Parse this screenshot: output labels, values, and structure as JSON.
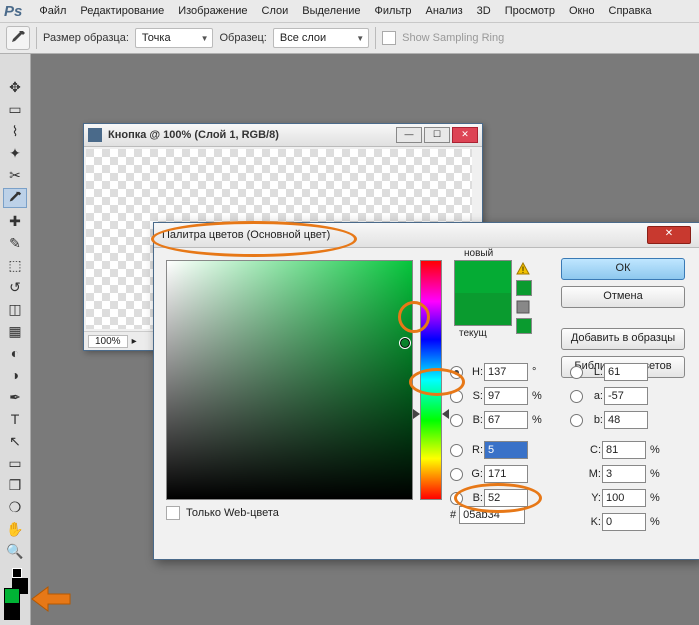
{
  "menu": {
    "logo": "Ps",
    "items": [
      "Файл",
      "Редактирование",
      "Изображение",
      "Слои",
      "Выделение",
      "Фильтр",
      "Анализ",
      "3D",
      "Просмотр",
      "Окно",
      "Справка"
    ]
  },
  "options": {
    "sample_label": "Размер образца:",
    "sample_value": "Точка",
    "target_label": "Образец:",
    "target_value": "Все слои",
    "ring": "Show Sampling Ring"
  },
  "doc": {
    "title": "Кнопка @ 100% (Слой 1, RGB/8)",
    "zoom": "100%"
  },
  "picker": {
    "title": "Палитра цветов (Основной цвет)",
    "new_label": "новый",
    "current_label": "текущ",
    "ok": "ОК",
    "cancel": "Отмена",
    "add": "Добавить в образцы",
    "libs": "Библиотеки цветов",
    "H": {
      "l": "H:",
      "v": "137",
      "u": "°"
    },
    "S": {
      "l": "S:",
      "v": "97",
      "u": "%"
    },
    "Bv": {
      "l": "B:",
      "v": "67",
      "u": "%"
    },
    "R": {
      "l": "R:",
      "v": "5",
      "u": ""
    },
    "G": {
      "l": "G:",
      "v": "171",
      "u": ""
    },
    "Bb": {
      "l": "B:",
      "v": "52",
      "u": ""
    },
    "L": {
      "l": "L:",
      "v": "61",
      "u": ""
    },
    "a": {
      "l": "a:",
      "v": "-57",
      "u": ""
    },
    "b": {
      "l": "b:",
      "v": "48",
      "u": ""
    },
    "C": {
      "l": "C:",
      "v": "81",
      "u": "%"
    },
    "M": {
      "l": "M:",
      "v": "3",
      "u": "%"
    },
    "Y": {
      "l": "Y:",
      "v": "100",
      "u": "%"
    },
    "K": {
      "l": "K:",
      "v": "0",
      "u": "%"
    },
    "hex_l": "#",
    "hex": "05ab34",
    "web": "Только Web-цвета"
  }
}
